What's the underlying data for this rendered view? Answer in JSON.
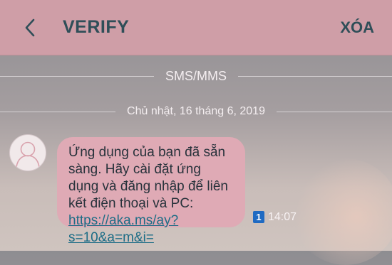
{
  "header": {
    "title": "VERIFY",
    "delete_label": "XÓA"
  },
  "conversation": {
    "channel_divider": "SMS/MMS",
    "date_divider": "Chủ nhật, 16 tháng 6, 2019"
  },
  "message": {
    "text": "Ứng dụng của bạn đã sẵn sàng. Hãy cài đặt ứng dụng và đăng nhập để liên kết điện thoại và PC: ",
    "link": "https://aka.ms/ay?s=10&a=m&i=",
    "sim_slot": "1",
    "time": "14:07"
  },
  "colors": {
    "header_bg": "#cf9ea7",
    "bubble_bg": "#dfaab5",
    "title_text": "#2f4e58",
    "link": "#1d6d86",
    "sim_badge": "#1f6ac2"
  },
  "icons": {
    "back": "chevron-left-icon",
    "avatar": "person-avatar-icon"
  }
}
